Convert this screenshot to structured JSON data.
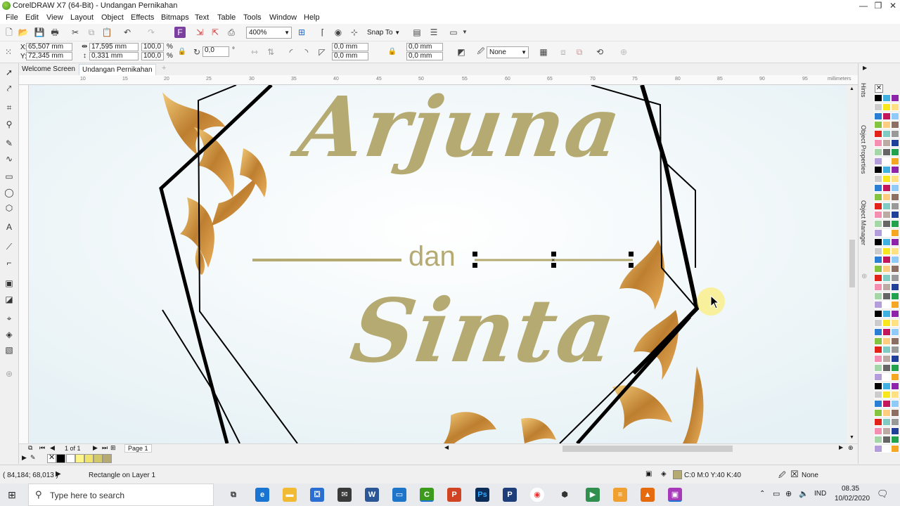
{
  "window": {
    "title": "CorelDRAW X7 (64-Bit) - Undangan Pernikahan",
    "controls": [
      "—",
      "❐",
      "✕"
    ]
  },
  "menu": [
    "File",
    "Edit",
    "View",
    "Layout",
    "Object",
    "Effects",
    "Bitmaps",
    "Text",
    "Table",
    "Tools",
    "Window",
    "Help"
  ],
  "toolbar": {
    "zoom": "400%",
    "snap_to": "Snap To"
  },
  "property_bar": {
    "x": "65,507 mm",
    "y": "72,345 mm",
    "x_label": "X:",
    "y_label": "Y:",
    "width": "17,595 mm",
    "height": "0,331 mm",
    "scale_w": "100,0",
    "scale_h": "100,0",
    "percent": "%",
    "rotation": "0,0",
    "degree": "°",
    "corner_1": "0,0 mm",
    "corner_2": "0,0 mm",
    "corner_3": "0,0 mm",
    "corner_4": "0,0 mm",
    "outline": "None"
  },
  "doc_tabs": [
    "Welcome Screen",
    "Undangan Pernikahan"
  ],
  "ruler": {
    "ticks": [
      "10",
      "15",
      "20",
      "25",
      "30",
      "35",
      "40",
      "45",
      "50",
      "55",
      "60",
      "65",
      "70",
      "75",
      "80",
      "85",
      "90",
      "95"
    ],
    "unit": "millimeters"
  },
  "canvas": {
    "name_top": "Arjuna",
    "conjunction": "dan",
    "name_bottom": "Sinta"
  },
  "page_nav": {
    "count": "1 of 1",
    "page": "Page 1"
  },
  "status": {
    "coords": "( 84,184; 68,013 )",
    "selection": "Rectangle on Layer 1",
    "fill": "C:0 M:0 Y:40 K:40",
    "outline": "None"
  },
  "docker_tabs": [
    "Hints",
    "Object Properties",
    "Object Manager"
  ],
  "taskbar": {
    "search_placeholder": "Type here to search",
    "time": "08.35",
    "date": "10/02/2020",
    "lang": "IND"
  },
  "colors": {
    "gold_text": "#b5aa72",
    "gold_ornament": "#c98c2a",
    "canvas_bg": "#eef5f8"
  }
}
